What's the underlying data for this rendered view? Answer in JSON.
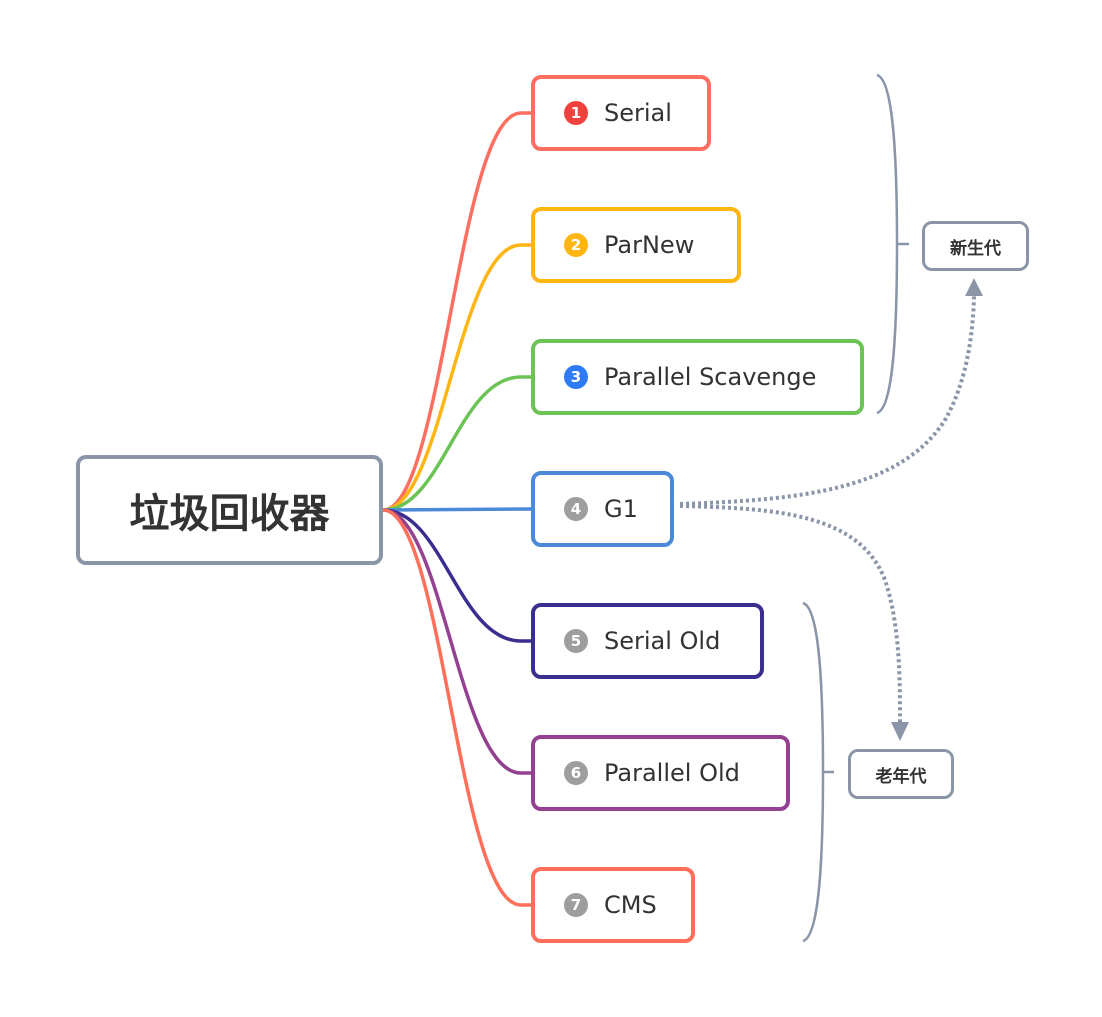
{
  "root": {
    "label": "垃圾回收器",
    "border_color": "#8a96a8"
  },
  "collectors": [
    {
      "index": "1",
      "label": "Serial",
      "color": "#ff6f61",
      "badge_color": "#f1413d",
      "group": "young"
    },
    {
      "index": "2",
      "label": "ParNew",
      "color": "#ffb612",
      "badge_color": "#ffb612",
      "group": "young"
    },
    {
      "index": "3",
      "label": "Parallel Scavenge",
      "color": "#6cc356",
      "badge_color": "#2f7af5",
      "group": "young"
    },
    {
      "index": "4",
      "label": "G1",
      "color": "#4a8ad8",
      "badge_color": "#9e9e9e",
      "group": "both"
    },
    {
      "index": "5",
      "label": "Serial Old",
      "color": "#3a2f8f",
      "badge_color": "#9e9e9e",
      "group": "old"
    },
    {
      "index": "6",
      "label": "Parallel Old",
      "color": "#934190",
      "badge_color": "#9e9e9e",
      "group": "old"
    },
    {
      "index": "7",
      "label": "CMS",
      "color": "#ff6f5a",
      "badge_color": "#9e9e9e",
      "group": "old"
    }
  ],
  "summaries": {
    "young": {
      "label": "新生代"
    },
    "old": {
      "label": "老年代"
    }
  },
  "relationships": [
    {
      "from": "G1",
      "to": "新生代",
      "style": "dotted-arrow"
    },
    {
      "from": "G1",
      "to": "老年代",
      "style": "dotted-arrow"
    }
  ],
  "colors": {
    "bracket": "#8a96a8",
    "relationship": "#8a96a8",
    "text": "#333333"
  }
}
